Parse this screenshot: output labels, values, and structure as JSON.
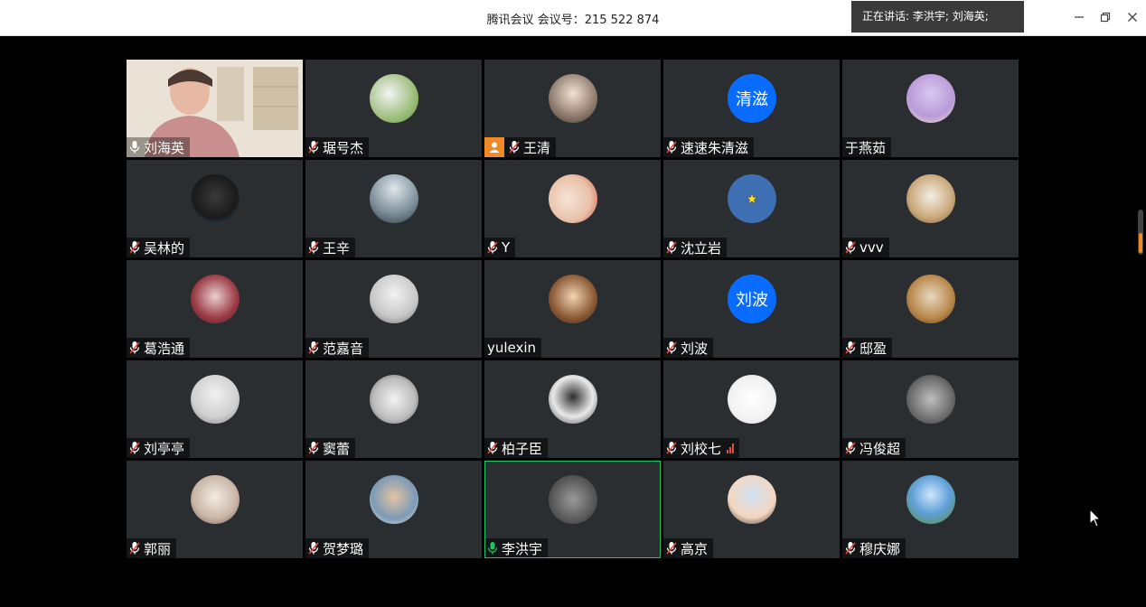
{
  "window": {
    "title": "腾讯会议 会议号：215 522 874",
    "speaking": "正在讲话: 李洪宇; 刘海英;",
    "controls": [
      "minimize",
      "restore",
      "close"
    ]
  },
  "colors": {
    "tile_bg": "#2b2e31",
    "mic_muted": "#e64a3b",
    "mic_active": "#17c564",
    "host_badge": "#f08a24",
    "initials_avatar": "#0a6cff"
  },
  "participants": [
    {
      "name": "刘海英",
      "mic": "on",
      "avatar": "video",
      "host": false
    },
    {
      "name": "琚号杰",
      "mic": "muted",
      "avatar": "image",
      "host": false
    },
    {
      "name": "王清",
      "mic": "muted",
      "avatar": "image",
      "host": true
    },
    {
      "name": "速速朱清滋",
      "mic": "muted",
      "avatar": "initials",
      "initials": "清滋",
      "host": false
    },
    {
      "name": "于燕茹",
      "mic": "none",
      "avatar": "image",
      "host": false
    },
    {
      "name": "吴林的",
      "mic": "muted",
      "avatar": "image",
      "host": false
    },
    {
      "name": "王辛",
      "mic": "muted",
      "avatar": "image",
      "host": false
    },
    {
      "name": "Y",
      "mic": "muted",
      "avatar": "image",
      "host": false
    },
    {
      "name": "沈立岩",
      "mic": "muted",
      "avatar": "star",
      "host": false
    },
    {
      "name": "vvv",
      "mic": "muted",
      "avatar": "image",
      "host": false
    },
    {
      "name": "葛浩通",
      "mic": "muted",
      "avatar": "image",
      "host": false
    },
    {
      "name": "范嘉音",
      "mic": "muted",
      "avatar": "image",
      "host": false
    },
    {
      "name": "yulexin",
      "mic": "none",
      "avatar": "image",
      "host": false
    },
    {
      "name": "刘波",
      "mic": "muted",
      "avatar": "initials",
      "initials": "刘波",
      "host": false
    },
    {
      "name": "邸盈",
      "mic": "muted",
      "avatar": "image",
      "host": false
    },
    {
      "name": "刘亭亭",
      "mic": "muted",
      "avatar": "image",
      "host": false
    },
    {
      "name": "窦蕾",
      "mic": "muted",
      "avatar": "image",
      "host": false
    },
    {
      "name": "柏子臣",
      "mic": "muted",
      "avatar": "image",
      "host": false
    },
    {
      "name": "刘校七",
      "mic": "muted",
      "avatar": "image",
      "host": false,
      "signal": "weak"
    },
    {
      "name": "冯俊超",
      "mic": "muted",
      "avatar": "image",
      "host": false
    },
    {
      "name": "郭丽",
      "mic": "muted",
      "avatar": "image",
      "host": false
    },
    {
      "name": "贺梦璐",
      "mic": "muted",
      "avatar": "image",
      "host": false
    },
    {
      "name": "李洪宇",
      "mic": "speaking",
      "avatar": "image",
      "host": false,
      "active": true
    },
    {
      "name": "高京",
      "mic": "muted",
      "avatar": "image",
      "host": false
    },
    {
      "name": "穆庆娜",
      "mic": "muted",
      "avatar": "image",
      "host": false
    }
  ]
}
